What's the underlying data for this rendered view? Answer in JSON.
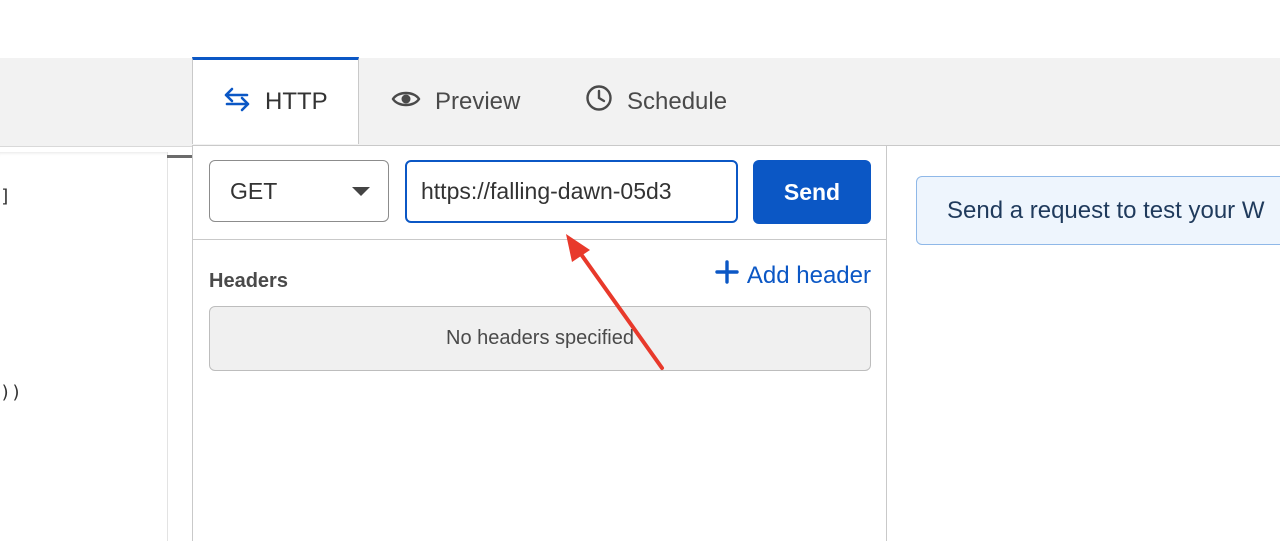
{
  "editor": {
    "code_lines": [
      "]",
      "))"
    ]
  },
  "tabs": [
    {
      "label": "HTTP",
      "icon": "arrows-swap-icon",
      "active": true
    },
    {
      "label": "Preview",
      "icon": "eye-icon",
      "active": false
    },
    {
      "label": "Schedule",
      "icon": "clock-icon",
      "active": false
    }
  ],
  "request": {
    "method": "GET",
    "url": "https://falling-dawn-05d3",
    "send_label": "Send",
    "headers_label": "Headers",
    "add_header_label": "Add header",
    "no_headers_text": "No headers specified"
  },
  "response": {
    "banner_text": "Send a request to test your W"
  },
  "colors": {
    "accent": "#0b57c5",
    "annotation": "#e8392b"
  }
}
